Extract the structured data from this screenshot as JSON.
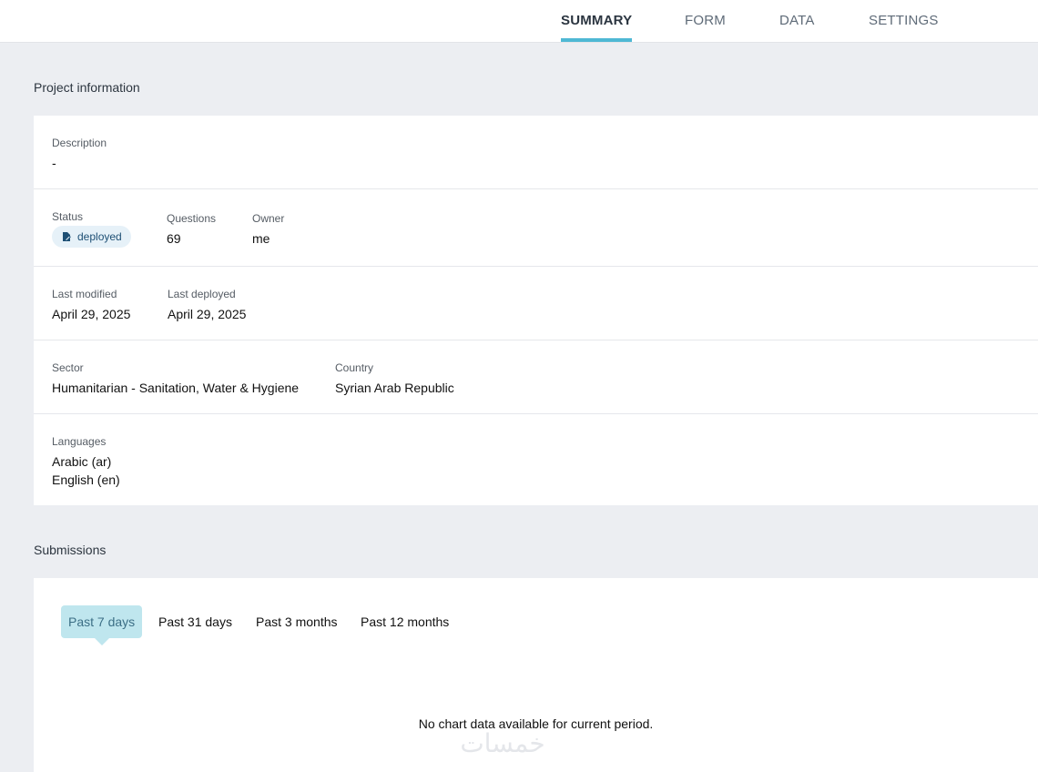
{
  "tabs": [
    {
      "label": "SUMMARY",
      "active": true
    },
    {
      "label": "FORM",
      "active": false
    },
    {
      "label": "DATA",
      "active": false
    },
    {
      "label": "SETTINGS",
      "active": false
    }
  ],
  "project_info": {
    "title": "Project information",
    "description": {
      "label": "Description",
      "value": "-"
    },
    "status": {
      "label": "Status",
      "value": "deployed"
    },
    "questions": {
      "label": "Questions",
      "value": "69"
    },
    "owner": {
      "label": "Owner",
      "value": "me"
    },
    "last_modified": {
      "label": "Last modified",
      "value": "April 29, 2025"
    },
    "last_deployed": {
      "label": "Last deployed",
      "value": "April 29, 2025"
    },
    "sector": {
      "label": "Sector",
      "value": "Humanitarian - Sanitation, Water & Hygiene"
    },
    "country": {
      "label": "Country",
      "value": "Syrian Arab Republic"
    },
    "languages": {
      "label": "Languages",
      "values": [
        "Arabic (ar)",
        "English (en)"
      ]
    }
  },
  "submissions": {
    "title": "Submissions",
    "periods": [
      "Past 7 days",
      "Past 31 days",
      "Past 3 months",
      "Past 12 months"
    ],
    "active_period": "Past 7 days",
    "empty_message": "No chart data available for current period."
  },
  "watermark": "خمسات",
  "colors": {
    "accent": "#4fb8d4",
    "badge_bg": "#e6f1f8",
    "period_active_bg": "#bfe6ee"
  }
}
